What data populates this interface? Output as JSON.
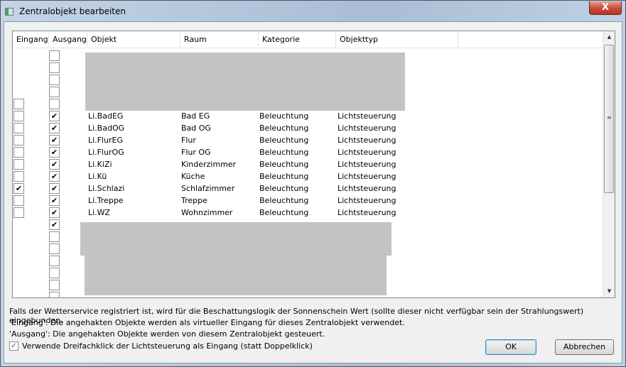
{
  "window": {
    "title": "Zentralobjekt bearbeiten",
    "close": "X"
  },
  "grid": {
    "columns": [
      "Eingang",
      "Ausgang",
      "Objekt",
      "Raum",
      "Kategorie",
      "Objekttyp"
    ],
    "rows": [
      {
        "eingang": null,
        "ausgang": false
      },
      {
        "eingang": null,
        "ausgang": false
      },
      {
        "eingang": null,
        "ausgang": false
      },
      {
        "eingang": null,
        "ausgang": false
      },
      {
        "eingang": false,
        "ausgang": false
      },
      {
        "eingang": false,
        "ausgang": true,
        "objekt": "Li.BadEG",
        "raum": "Bad EG",
        "kategorie": "Beleuchtung",
        "objekttyp": "Lichtsteuerung"
      },
      {
        "eingang": false,
        "ausgang": true,
        "objekt": "Li.BadOG",
        "raum": "Bad OG",
        "kategorie": "Beleuchtung",
        "objekttyp": "Lichtsteuerung"
      },
      {
        "eingang": false,
        "ausgang": true,
        "objekt": "Li.FlurEG",
        "raum": "Flur",
        "kategorie": "Beleuchtung",
        "objekttyp": "Lichtsteuerung"
      },
      {
        "eingang": false,
        "ausgang": true,
        "objekt": "Li.FlurOG",
        "raum": "Flur OG",
        "kategorie": "Beleuchtung",
        "objekttyp": "Lichtsteuerung"
      },
      {
        "eingang": false,
        "ausgang": true,
        "objekt": "Li.KiZi",
        "raum": "Kinderzimmer",
        "kategorie": "Beleuchtung",
        "objekttyp": "Lichtsteuerung"
      },
      {
        "eingang": false,
        "ausgang": true,
        "objekt": "Li.Kü",
        "raum": "Küche",
        "kategorie": "Beleuchtung",
        "objekttyp": "Lichtsteuerung"
      },
      {
        "eingang": true,
        "ausgang": true,
        "objekt": "Li.Schlazi",
        "raum": "Schlafzimmer",
        "kategorie": "Beleuchtung",
        "objekttyp": "Lichtsteuerung"
      },
      {
        "eingang": false,
        "ausgang": true,
        "objekt": "Li.Treppe",
        "raum": "Treppe",
        "kategorie": "Beleuchtung",
        "objekttyp": "Lichtsteuerung"
      },
      {
        "eingang": false,
        "ausgang": true,
        "objekt": "Li.WZ",
        "raum": "Wohnzimmer",
        "kategorie": "Beleuchtung",
        "objekttyp": "Lichtsteuerung"
      },
      {
        "eingang": null,
        "ausgang": true
      },
      {
        "eingang": null,
        "ausgang": false
      },
      {
        "eingang": null,
        "ausgang": false
      },
      {
        "eingang": null,
        "ausgang": false
      },
      {
        "eingang": null,
        "ausgang": false
      },
      {
        "eingang": null,
        "ausgang": false
      },
      {
        "eingang": null,
        "ausgang": false
      }
    ],
    "scroll_position": 0.0
  },
  "notes": [
    "Falls der Wetterservice registriert ist, wird für die Beschattungslogik der Sonnenschein Wert (sollte dieser nicht verfügbar sein der Strahlungswert) eingebunden.",
    "'Eingang': Die angehakten Objekte werden als virtueller Eingang für dieses Zentralobjekt verwendet.",
    "'Ausgang': Die angehakten Objekte werden von diesem Zentralobjekt gesteuert."
  ],
  "option": {
    "label": "Verwende Dreifachklick der Lichtsteuerung als Eingang (statt Doppelklick)",
    "checked": true
  },
  "buttons": {
    "ok": "OK",
    "cancel": "Abbrechen"
  },
  "check_glyph": "✔"
}
